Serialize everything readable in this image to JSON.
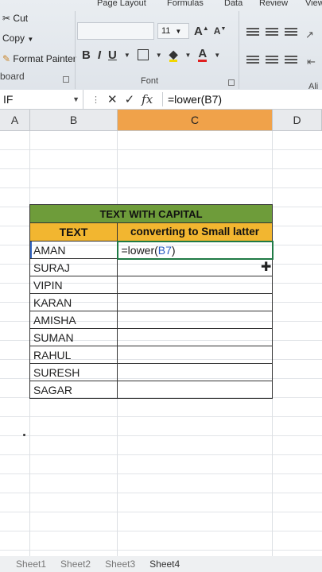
{
  "ribbon": {
    "tabs": [
      "Page Layout",
      "Formulas",
      "Data",
      "Review",
      "View"
    ],
    "clipboard": {
      "cut": "Cut",
      "copy": "Copy",
      "format_painter": "Format Painter",
      "group_label": "board"
    },
    "font": {
      "size": "11",
      "group_label": "Font",
      "bold": "B",
      "italic": "I",
      "underline": "U",
      "grow": "A",
      "shrink": "A",
      "font_color": "A"
    },
    "alignment": {
      "group_label": "Ali"
    }
  },
  "formula_bar": {
    "name_box": "IF",
    "cancel": "✕",
    "enter": "✓",
    "fx": "fx",
    "content": "=lower(B7)"
  },
  "columns": [
    "A",
    "B",
    "C",
    "D"
  ],
  "table": {
    "title": "TEXT WITH CAPITAL",
    "header_text": "TEXT",
    "header_lower": "converting to Small latter",
    "editing_formula_prefix": "=lower(",
    "editing_formula_ref": "B7",
    "editing_formula_suffix": ")",
    "names": [
      "AMAN",
      "SURAJ",
      "VIPIN",
      "KARAN",
      "AMISHA",
      "SUMAN",
      "RAHUL",
      "SURESH",
      "SAGAR"
    ]
  },
  "sheet_tabs": [
    "Sheet1",
    "Sheet2",
    "Sheet3",
    "Sheet4"
  ],
  "colors": {
    "title_bg": "#6e9c3a",
    "header_bg": "#f2b630",
    "active_col": "#f0a24a",
    "edit_border": "#1f7a45",
    "ref_blue": "#2a5cc4"
  }
}
